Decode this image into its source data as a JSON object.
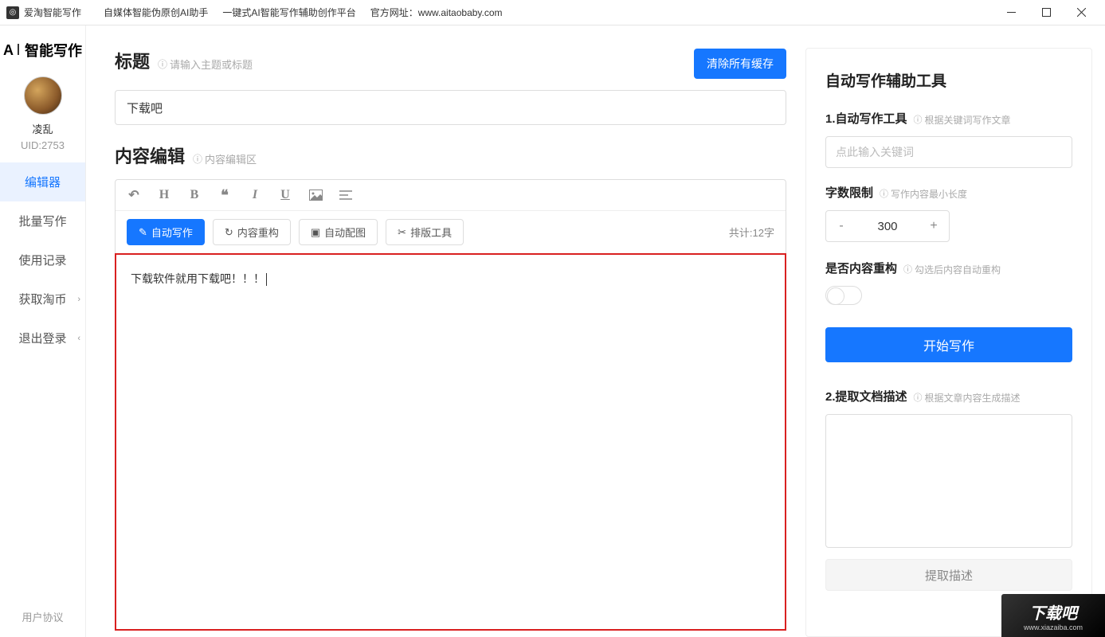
{
  "titlebar": {
    "app_name": "爱淘智能写作",
    "tagline1": "自媒体智能伪原创AI助手",
    "tagline2": "一键式AI智能写作辅助创作平台",
    "website_label": "官方网址：www.aitaobaby.com"
  },
  "sidebar": {
    "logo": "智能写作",
    "username": "凌乱",
    "uid": "UID:2753",
    "nav": {
      "editor": "编辑器",
      "batch": "批量写作",
      "history": "使用记录",
      "coins": "获取淘币",
      "logout": "退出登录"
    },
    "footer": "用户协议"
  },
  "editor": {
    "title_label": "标题",
    "title_hint": "请输入主题或标题",
    "title_value": "下载吧",
    "clear_cache": "清除所有缓存",
    "content_label": "内容编辑",
    "content_hint": "内容编辑区",
    "actions": {
      "auto_write": "自动写作",
      "restructure": "内容重构",
      "auto_image": "自动配图",
      "layout_tool": "排版工具"
    },
    "word_count": "共计:12字",
    "body_text": "下载软件就用下载吧！！！"
  },
  "panel": {
    "title": "自动写作辅助工具",
    "sec1_title": "1.自动写作工具",
    "sec1_hint": "根据关键词写作文章",
    "keyword_placeholder": "点此输入关键词",
    "limit_title": "字数限制",
    "limit_hint": "写作内容最小长度",
    "limit_value": "300",
    "restructure_title": "是否内容重构",
    "restructure_hint": "勾选后内容自动重构",
    "start_btn": "开始写作",
    "sec2_title": "2.提取文档描述",
    "sec2_hint": "根据文章内容生成描述",
    "extract_btn": "提取描述"
  },
  "watermark": {
    "text": "下载吧",
    "url": "www.xiazaiba.com"
  }
}
